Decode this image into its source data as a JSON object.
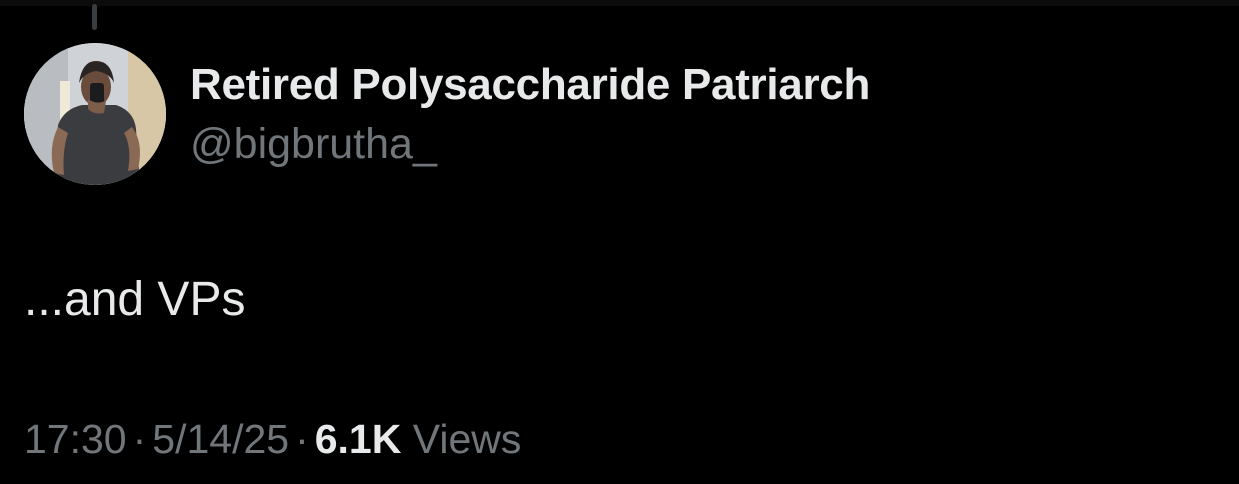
{
  "tweet": {
    "author": {
      "display_name": "Retired Polysaccharide Patriarch",
      "handle": "@bigbrutha_",
      "avatar_icon": "profile-photo"
    },
    "text": "...and VPs",
    "time": "17:30",
    "date": "5/14/25",
    "separator": "·",
    "views_count": "6.1K",
    "views_label": "Views"
  },
  "colors": {
    "background": "#000000",
    "primary_text": "#e7e9ea",
    "secondary_text": "#71767b"
  }
}
